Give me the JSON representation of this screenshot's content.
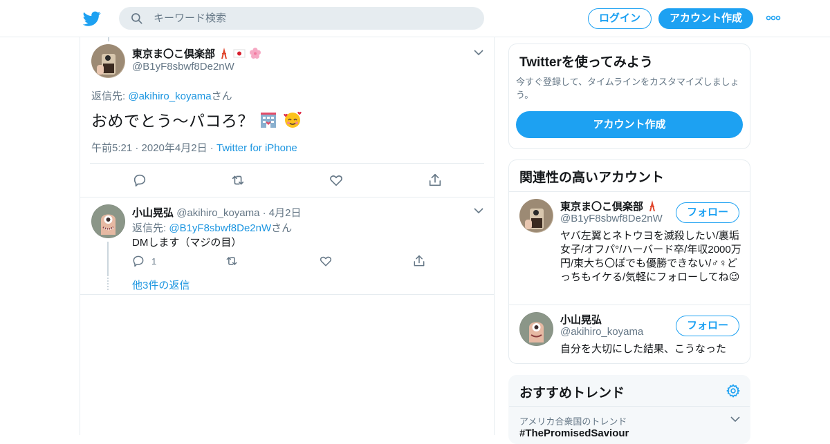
{
  "header": {
    "search_placeholder": "キーワード検索",
    "login_label": "ログイン",
    "signup_label": "アカウント作成",
    "brand_color": "#1da1f2"
  },
  "main_tweet": {
    "author_name": "東京ま〇こ倶楽部",
    "author_handle": "@B1yF8sbwf8De2nW",
    "reply_prefix": "返信先: ",
    "reply_to": "@akihiro_koyama",
    "reply_suffix": "さん",
    "text": "おめでとう〜パコろ？",
    "timestamp": "午前5:21 · 2020年4月2日",
    "meta_sep": " · ",
    "source": "Twitter for iPhone"
  },
  "reply_tweet": {
    "author_name": "小山晃弘",
    "author_handle": "@akihiro_koyama",
    "date": "· 4月2日",
    "reply_prefix": "返信先: ",
    "reply_to": "@B1yF8sbwf8De2nW",
    "reply_suffix": "さん",
    "text": "DMします（マジの目）",
    "reply_count": "1",
    "more_replies": "他3件の返信"
  },
  "signup_card": {
    "title": "Twitterを使ってみよう",
    "description": "今すぐ登録して、タイムラインをカスタマイズしましょう。",
    "button_label": "アカウント作成"
  },
  "related_accounts": {
    "title": "関連性の高いアカウント",
    "follow_label": "フォロー",
    "accounts": [
      {
        "name": "東京ま〇こ倶楽部",
        "handle": "@B1yF8sbwf8De2nW",
        "bio": "ヤバ左翼とネトウヨを滅殺したい/裏垢女子/オフパ°/ハーバード卒/年収2000万円/東大ち〇ぽでも優勝できない/♂♀どっちもイケる/気軽にフォローしてね😉"
      },
      {
        "name": "小山晃弘",
        "handle": "@akihiro_koyama",
        "bio": "自分を大切にした結果、こうなった"
      }
    ]
  },
  "trends": {
    "title": "おすすめトレンド",
    "items": [
      {
        "location": "アメリカ合衆国のトレンド",
        "name": "#ThePromisedSaviour"
      }
    ]
  }
}
